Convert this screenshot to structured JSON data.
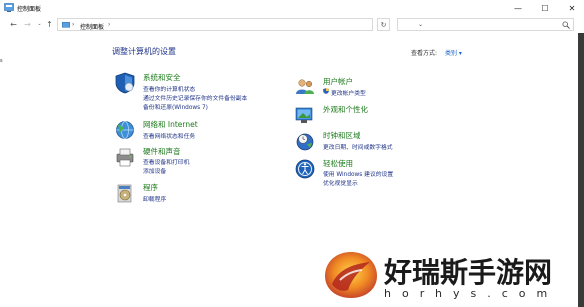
{
  "window": {
    "title": "控制面板",
    "minimize": "—",
    "maximize": "☐",
    "close": "✕"
  },
  "nav": {
    "back": "←",
    "forward": "→",
    "history": "⌄",
    "up": "↑",
    "address_sep": "›",
    "address": "控制面板",
    "crumb_sep": "›",
    "address_dropdown": "⌄",
    "refresh": "↻",
    "search_placeholder": ""
  },
  "left_mark": "s",
  "main": {
    "heading": "调整计算机的设置",
    "view_by_label": "查看方式:",
    "view_by_value": "类别 ▾"
  },
  "categories": {
    "system": {
      "title": "系统和安全",
      "links": [
        "查看你的计算机状态",
        "通过文件历史记录保存你的文件备份副本",
        "备份和还原(Windows 7)"
      ]
    },
    "network": {
      "title": "网络和 Internet",
      "links": [
        "查看网络状态和任务"
      ]
    },
    "hardware": {
      "title": "硬件和声音",
      "links": [
        "查看设备和打印机",
        "添加设备"
      ]
    },
    "programs": {
      "title": "程序",
      "links": [
        "卸载程序"
      ]
    },
    "accounts": {
      "title": "用户帐户",
      "links": [
        "更改帐户类型"
      ]
    },
    "appearance": {
      "title": "外观和个性化",
      "links": []
    },
    "clock": {
      "title": "时钟和区域",
      "links": [
        "更改日期、时间或数字格式"
      ]
    },
    "ease": {
      "title": "轻松使用",
      "links": [
        "使用 Windows 建议的设置",
        "优化视觉显示"
      ]
    }
  },
  "watermark": {
    "text": "好瑞斯手游网",
    "sub": "horhys.com"
  },
  "colors": {
    "heading": "#1e3287",
    "category_title": "#1a7a1a",
    "link": "#1e3287",
    "accent": "#1e66c6"
  }
}
